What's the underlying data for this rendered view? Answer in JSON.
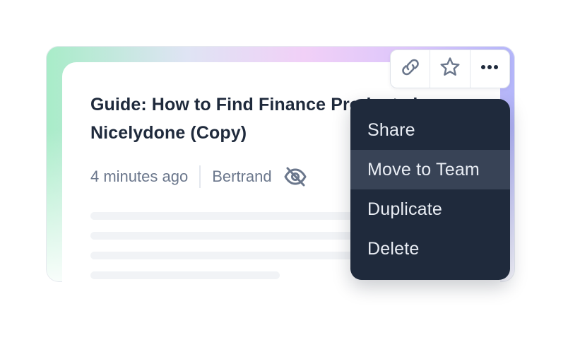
{
  "card": {
    "title": "Guide: How to Find Finance Products in Nicelydone (Copy)",
    "time_ago": "4 minutes ago",
    "author": "Bertrand",
    "visibility_icon": "eye-off-icon"
  },
  "toolbar": {
    "buttons": [
      {
        "icon": "link-icon",
        "label": "Copy link"
      },
      {
        "icon": "star-icon",
        "label": "Favorite"
      },
      {
        "icon": "more-horizontal-icon",
        "label": "More options"
      }
    ]
  },
  "menu": {
    "items": [
      {
        "label": "Share",
        "highlighted": false
      },
      {
        "label": "Move to Team",
        "highlighted": true
      },
      {
        "label": "Duplicate",
        "highlighted": false
      },
      {
        "label": "Delete",
        "highlighted": false
      }
    ]
  },
  "colors": {
    "menu_bg": "#1f2a3c",
    "menu_highlight": "#384356",
    "title_text": "#1f2a3c",
    "meta_text": "#6b778c"
  }
}
